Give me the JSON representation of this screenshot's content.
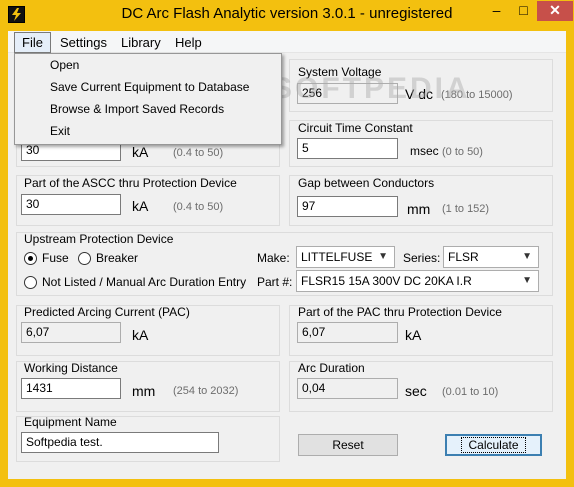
{
  "window": {
    "title": "DC Arc Flash Analytic version 3.0.1 - unregistered",
    "minimize_glyph": "–",
    "maximize_glyph": "□",
    "close_glyph": "✕",
    "icon": "arc-flash-app-icon",
    "accent_color": "#f3c00f"
  },
  "menu": {
    "items": [
      "File",
      "Settings",
      "Library",
      "Help"
    ],
    "file_dropdown": [
      "Open",
      "Save Current Equipment to Database",
      "Browse & Import Saved Records",
      "Exit"
    ]
  },
  "watermark": "SOFTPEDIA",
  "system_voltage": {
    "label": "System Voltage",
    "value": "256",
    "unit": "V dc",
    "range": "(180 to 15000)"
  },
  "ascc": {
    "value": "30",
    "unit": "kA",
    "range": "(0.4 to 50)"
  },
  "circuit_time_constant": {
    "label": "Circuit Time Constant",
    "value": "5",
    "unit": "msec",
    "range": "(0 to 50)"
  },
  "part_ascc": {
    "label": "Part of the ASCC thru Protection Device",
    "value": "30",
    "unit": "kA",
    "range": "(0.4 to 50)"
  },
  "gap": {
    "label": "Gap between Conductors",
    "value": "97",
    "unit": "mm",
    "range": "(1 to 152)"
  },
  "protection": {
    "label": "Upstream Protection Device",
    "options": [
      "Fuse",
      "Breaker",
      "Not Listed / Manual Arc Duration Entry"
    ],
    "selected": "Fuse",
    "make_label": "Make:",
    "make_value": "LITTELFUSE",
    "series_label": "Series:",
    "series_value": "FLSR",
    "part_label": "Part #:",
    "part_value": "FLSR15 15A 300V DC 20KA I.R"
  },
  "pac": {
    "label": "Predicted Arcing Current (PAC)",
    "value": "6,07",
    "unit": "kA"
  },
  "part_pac": {
    "label": "Part of the PAC thru Protection Device",
    "value": "6,07",
    "unit": "kA"
  },
  "working_distance": {
    "label": "Working Distance",
    "value": "1431",
    "unit": "mm",
    "range": "(254 to 2032)"
  },
  "arc_duration": {
    "label": "Arc Duration",
    "value": "0,04",
    "unit": "sec",
    "range": "(0.01 to 10)"
  },
  "equipment": {
    "label": "Equipment Name",
    "value": "Softpedia test."
  },
  "buttons": {
    "reset": "Reset",
    "calculate": "Calculate"
  }
}
